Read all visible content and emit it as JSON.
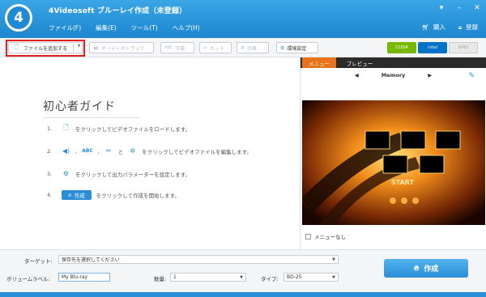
{
  "app": {
    "logo_text": "4",
    "title": "4Videosoft ブルーレイ作成（未登録）"
  },
  "menu": {
    "file": "ファイル(F)",
    "edit": "編集(E)",
    "tools": "ツール(T)",
    "help": "ヘルプ(H)"
  },
  "top_links": {
    "buy": "購入",
    "register": "登録"
  },
  "toolbar": {
    "add_file": "ファイルを追加する",
    "audio_track": "オーディオトラック",
    "subtitle": "字幕",
    "cut": "カット",
    "effect": "効果",
    "settings": "環境設定",
    "gpu": [
      "CUDA",
      "intel",
      "AMD"
    ]
  },
  "guide": {
    "title": "初心者ガイド",
    "steps": [
      {
        "num": "1.",
        "text": "をクリックしてビデオファイルをロードします。"
      },
      {
        "num": "2.",
        "icon_abc": "ABC",
        "and": "と",
        "text": "をクリックしてビデオファイルを編集します。"
      },
      {
        "num": "3.",
        "text": "をクリックして出力パラメーターを設定します。"
      },
      {
        "num": "4.",
        "button": "作成",
        "text": "をクリックして作成を開始します。"
      }
    ]
  },
  "right_panel": {
    "tab_menu": "メニュー",
    "tab_preview": "プレビュー",
    "template_name": "Memory",
    "preview_start": "START",
    "no_menu": "メニューなし"
  },
  "bottom": {
    "target_label": "ターゲット:",
    "target_value": "保存先を選択してください",
    "volume_label": "ボリュームラベル:",
    "volume_value": "My Blu-ray",
    "quantity_label": "数量:",
    "quantity_value": "1",
    "type_label": "タイプ:",
    "type_value": "BD-25",
    "create": "作成"
  },
  "colors": {
    "accent": "#2a8fd6",
    "tab_active": "#e8731a",
    "highlight": "#e02020"
  }
}
